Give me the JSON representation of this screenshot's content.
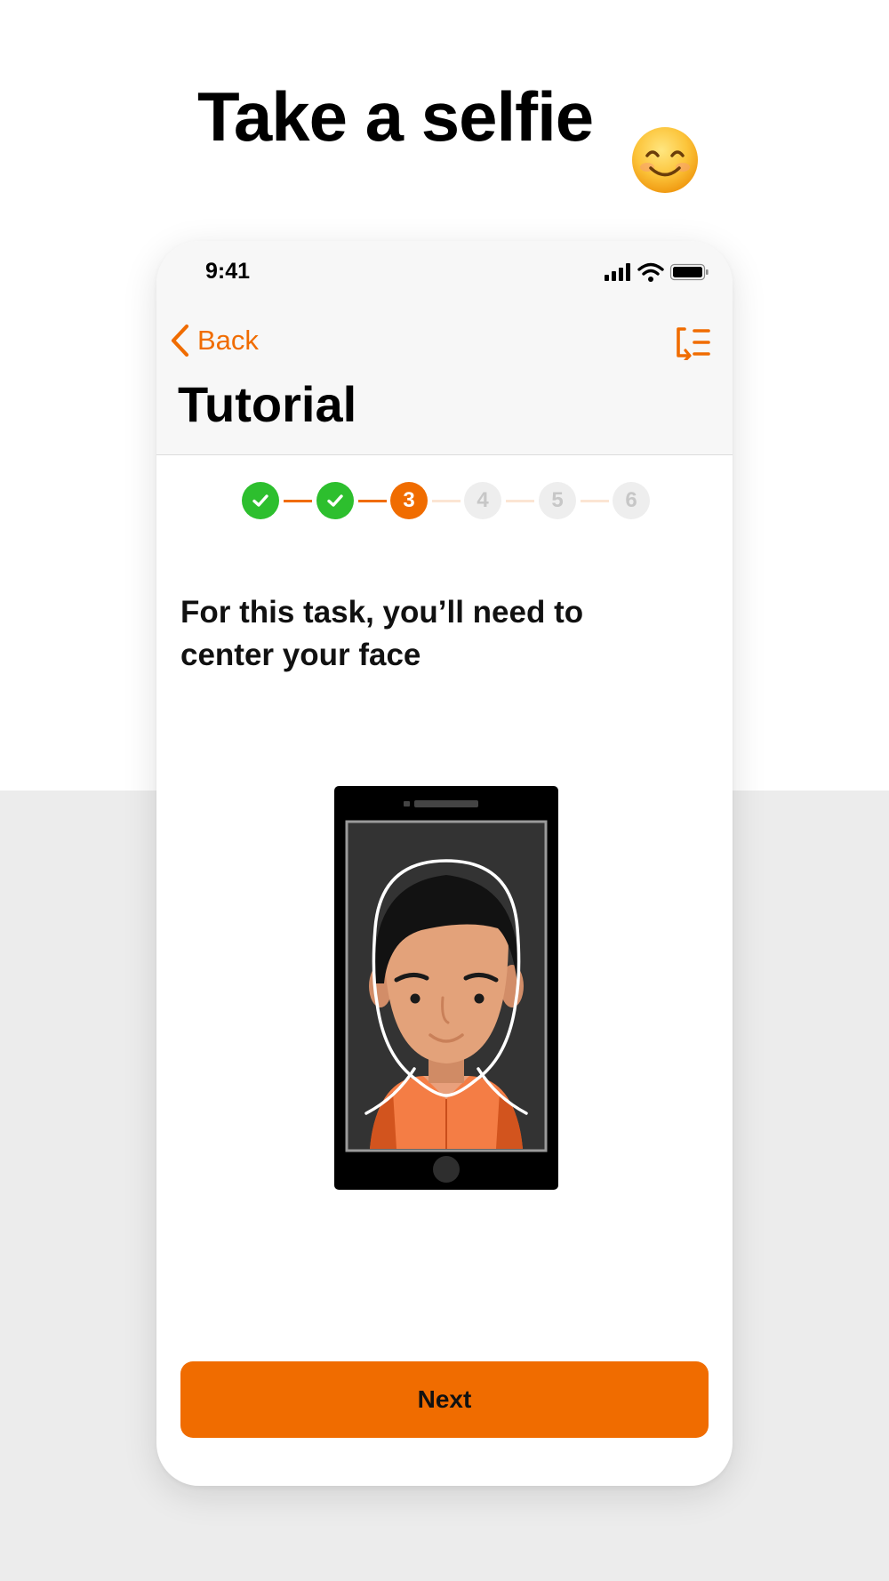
{
  "promo": {
    "headline": "Take a selfie",
    "emoji_icon": "smiling-face-icon"
  },
  "status_bar": {
    "time": "9:41",
    "icons": [
      "cellular-signal-icon",
      "wifi-icon",
      "battery-icon"
    ]
  },
  "nav": {
    "back_label": "Back",
    "back_icon": "chevron-left-icon",
    "menu_icon": "list-menu-icon",
    "title": "Tutorial"
  },
  "stepper": {
    "steps": [
      {
        "label": "1",
        "state": "done"
      },
      {
        "label": "2",
        "state": "done"
      },
      {
        "label": "3",
        "state": "current"
      },
      {
        "label": "4",
        "state": "todo"
      },
      {
        "label": "5",
        "state": "todo"
      },
      {
        "label": "6",
        "state": "todo"
      }
    ]
  },
  "content": {
    "instruction": "For this task, you’ll need to center your face",
    "illustration": "phone-selfie-face-outline-icon"
  },
  "footer": {
    "next_label": "Next"
  },
  "colors": {
    "accent": "#f06c00",
    "success": "#2dbf2e",
    "inactive_step": "#eeeeee",
    "page_bg_lower": "#ececec"
  }
}
